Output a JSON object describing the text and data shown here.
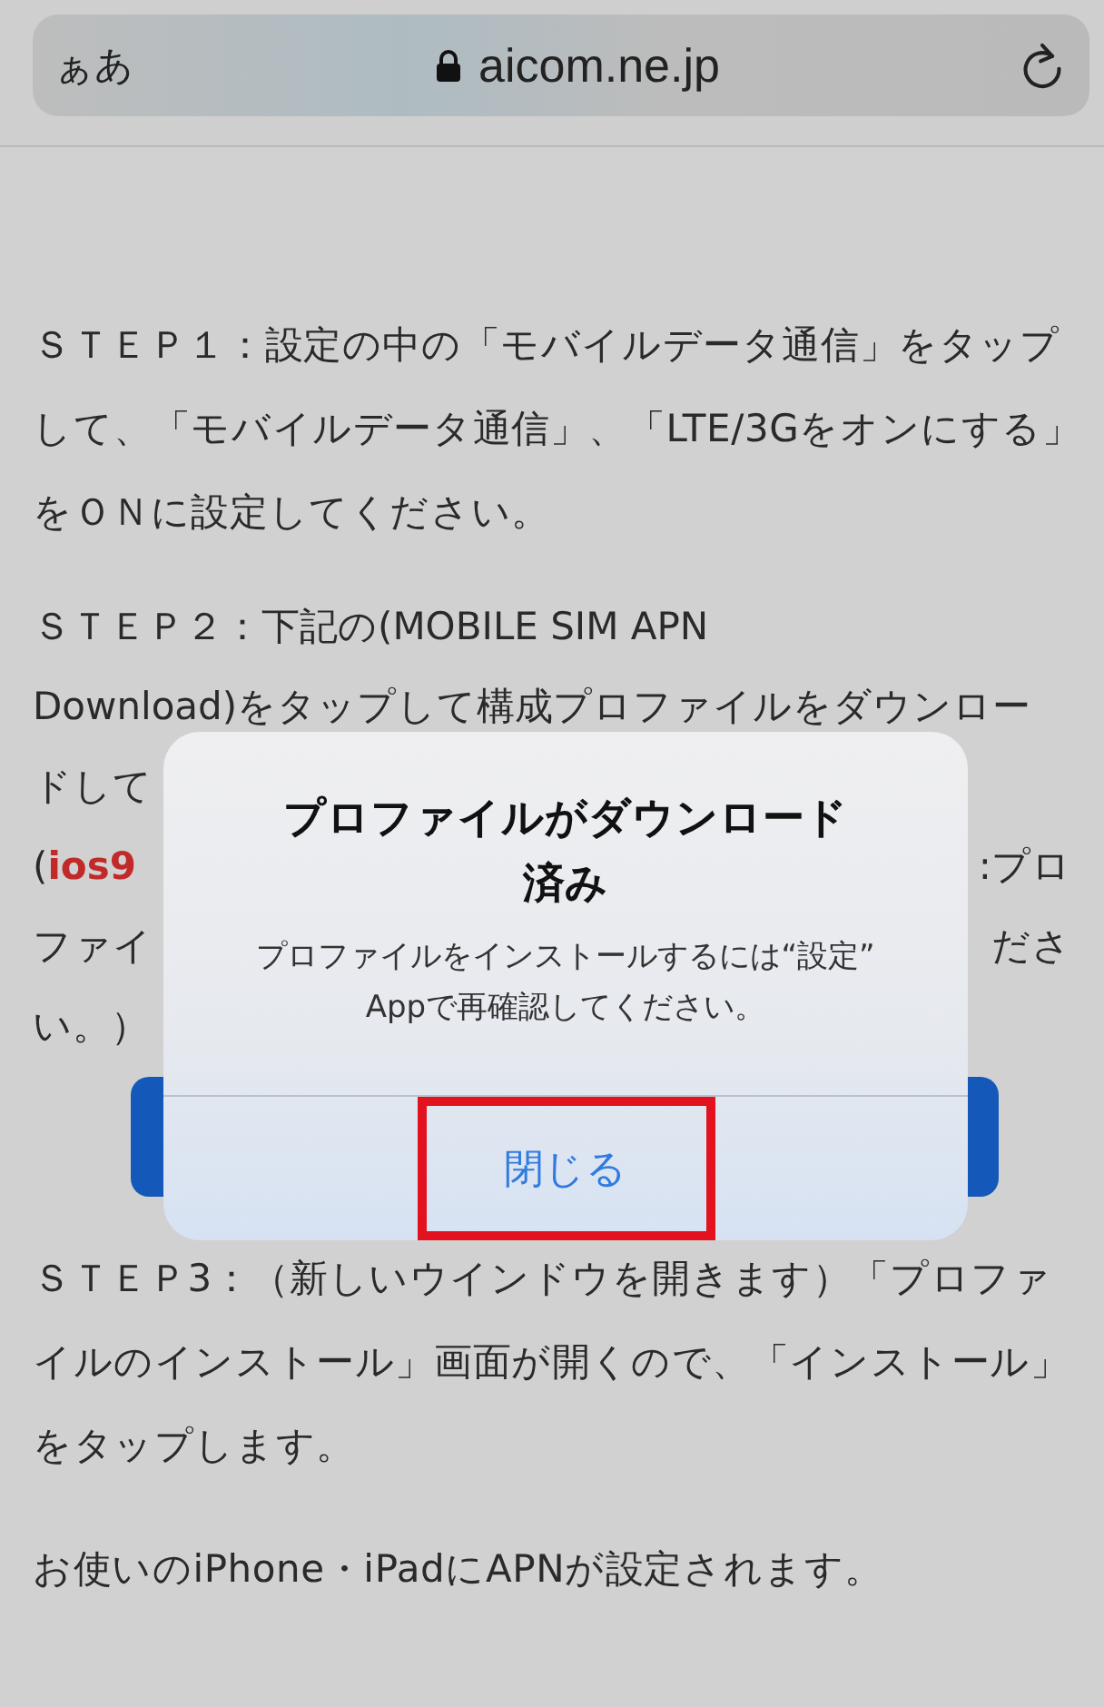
{
  "address_bar": {
    "text_size_label": "ぁあ",
    "url": "aicom.ne.jp",
    "secure": true
  },
  "step1": "ＳＴＥＰ１：設定の中の「モバイルデータ通信」をタップして、「モバイルデータ通信」、「LTE/3Gをオンにする」をＯＮに設定してください。",
  "step2_lines": [
    {
      "segments": [
        {
          "kind": "plain",
          "text": "ＳＴＥＰ２：下記の(MOBILE SIM APN"
        }
      ]
    },
    {
      "segments": [
        {
          "kind": "plain",
          "text": "Download)をタップして構成プロファイルをダウンロー"
        }
      ]
    },
    {
      "segments": [
        {
          "kind": "plain",
          "text": "ドして"
        }
      ]
    },
    {
      "segments": [
        {
          "kind": "plain",
          "text": "("
        },
        {
          "kind": "link",
          "text": "ios9"
        }
      ],
      "right": ":プロ"
    },
    {
      "segments": [
        {
          "kind": "plain",
          "text": "ファイ"
        }
      ],
      "right": "ださ"
    },
    {
      "segments": [
        {
          "kind": "plain",
          "text": "い。）"
        }
      ]
    }
  ],
  "download_button": {
    "kind": "covered"
  },
  "step3": "ＳＴＥＰ3：（新しいウインドウを開きます）「プロファイルのインストール」画面が開くので、「インストール」をタップします。",
  "note": "お使いのiPhone・iPadにAPNが設定されます。",
  "dialog": {
    "title": "プロファイルがダウンロード済み",
    "message": "プロファイルをインストールするには“設定” Appで再確認してください。",
    "button": {
      "label": "閉じる",
      "highlighted": true
    }
  }
}
